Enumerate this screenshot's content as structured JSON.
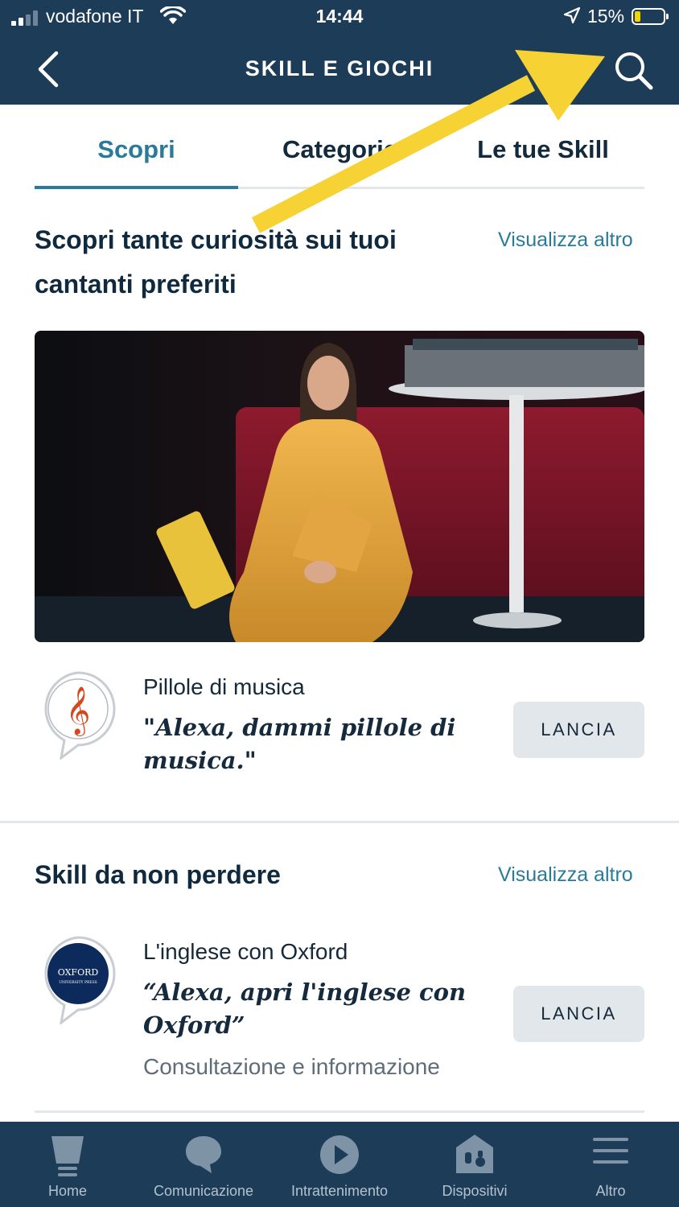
{
  "status_bar": {
    "carrier": "vodafone IT",
    "time": "14:44",
    "battery_percent": "15%",
    "battery_level": 0.15,
    "battery_color": "#f2d400"
  },
  "header": {
    "title": "SKILL E GIOCHI",
    "back_icon": "chevron-left-icon",
    "search_icon": "search-icon"
  },
  "tabs": [
    {
      "label": "Scopri",
      "active": true
    },
    {
      "label": "Categorie",
      "active": false
    },
    {
      "label": "Le tue Skill",
      "active": false
    }
  ],
  "sections": [
    {
      "title_line1": "Scopri tante curiosità sui tuoi",
      "title_line2": "cantanti preferiti",
      "see_more": "Visualizza altro",
      "skill": {
        "name": "Pillole di musica",
        "phrase_line1": "\"Alexa, dammi pillole di",
        "phrase_line2": "musica.\"",
        "button": "LANCIA",
        "icon": "treble-clef-icon"
      }
    },
    {
      "title": "Skill da non perdere",
      "see_more": "Visualizza altro",
      "skill": {
        "name": "L'inglese con Oxford",
        "phrase_line1": "“Alexa, apri l'inglese con",
        "phrase_line2": "Oxford”",
        "category": "Consultazione e informazione",
        "button": "LANCIA",
        "icon_text_top": "OXFORD",
        "icon_text_bottom": "UNIVERSITY PRESS"
      }
    }
  ],
  "bottom_nav": [
    {
      "label": "Home",
      "icon": "home-icon"
    },
    {
      "label": "Comunicazione",
      "icon": "chat-bubble-icon"
    },
    {
      "label": "Intrattenimento",
      "icon": "play-icon"
    },
    {
      "label": "Dispositivi",
      "icon": "devices-house-icon"
    },
    {
      "label": "Altro",
      "icon": "menu-icon"
    }
  ],
  "colors": {
    "header_bg": "#1d3c58",
    "accent": "#2a7b9b",
    "annotation_arrow": "#f7d234"
  }
}
